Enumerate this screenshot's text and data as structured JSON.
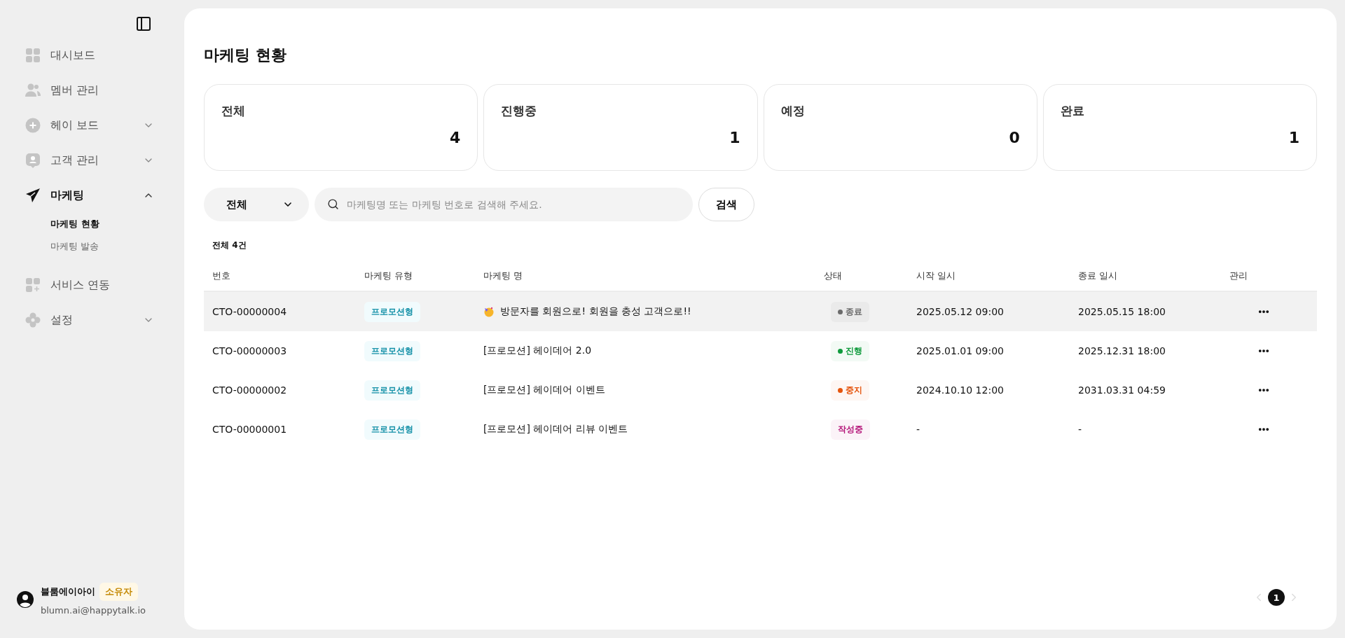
{
  "sidebar": {
    "items": [
      {
        "label": "대시보드",
        "kind": "grid",
        "selected": false
      },
      {
        "label": "멤버 관리",
        "kind": "people",
        "selected": false
      },
      {
        "label": "헤이 보드",
        "kind": "plus",
        "selected": false,
        "expanded": false
      },
      {
        "label": "고객 관리",
        "kind": "person",
        "selected": false,
        "expanded": false
      },
      {
        "label": "마케팅",
        "kind": "send",
        "selected": true,
        "expanded": true,
        "children": [
          {
            "label": "마케팅 현황",
            "selected": true
          },
          {
            "label": "마케팅 발송",
            "selected": false
          }
        ]
      },
      {
        "label": "서비스 연동",
        "kind": "gridplus",
        "selected": false
      },
      {
        "label": "설정",
        "kind": "gear",
        "selected": false,
        "expanded": false
      }
    ],
    "user": {
      "name": "블룸에이아이",
      "role": "소유자",
      "email": "blumn.ai@happytalk.io"
    }
  },
  "page_title": "마케팅 현황",
  "stats": [
    {
      "label": "전체",
      "value": "4"
    },
    {
      "label": "진행중",
      "value": "1"
    },
    {
      "label": "예정",
      "value": "0"
    },
    {
      "label": "완료",
      "value": "1"
    }
  ],
  "filter": {
    "value": "전체",
    "search_placeholder": "마케팅명 또는 마케팅 번호로 검색해 주세요.",
    "search_button": "검색"
  },
  "total": "전체 4건",
  "table": {
    "columns": [
      "번호",
      "마케팅 유형",
      "마케팅 명",
      "상태",
      "시작 일시",
      "종료 일시",
      "관리"
    ],
    "rows": [
      {
        "id": "CTO-00000004",
        "type": "프로모션형",
        "name": "방문자를 회원으로! 회원을 충성 고객으로!!",
        "has_emoji": true,
        "status": {
          "label": "종료",
          "color": "#6b6b6b",
          "dot": true
        },
        "start": "2025.05.12 09:00",
        "end": "2025.05.15 18:00",
        "selected": true
      },
      {
        "id": "CTO-00000003",
        "type": "프로모션형",
        "name": "[프로모션] 헤이데어 2.0",
        "has_emoji": false,
        "status": {
          "label": "진행",
          "color": "#0f9a3c",
          "dot": true
        },
        "start": "2025.01.01 09:00",
        "end": "2025.12.31 18:00",
        "selected": false
      },
      {
        "id": "CTO-00000002",
        "type": "프로모션형",
        "name": "[프로모션] 헤이데어 이벤트",
        "has_emoji": false,
        "status": {
          "label": "중지",
          "color": "#e5540c",
          "dot": true
        },
        "start": "2024.10.10 12:00",
        "end": "2031.03.31 04:59",
        "selected": false
      },
      {
        "id": "CTO-00000001",
        "type": "프로모션형",
        "name": "[프로모션] 헤이데어 리뷰 이벤트",
        "has_emoji": false,
        "status": {
          "label": "작성중",
          "color": "#b5177a",
          "dot": false
        },
        "start": "-",
        "end": "-",
        "selected": false
      }
    ]
  },
  "pagination": {
    "pages": [
      {
        "label": "1",
        "selected": true
      }
    ]
  }
}
